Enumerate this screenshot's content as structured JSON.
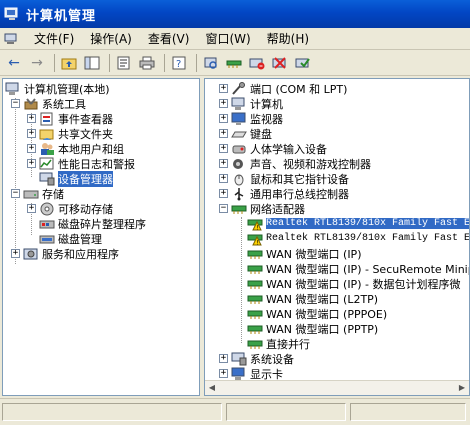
{
  "window": {
    "title": "计算机管理"
  },
  "menu": [
    "文件(F)",
    "操作(A)",
    "查看(V)",
    "窗口(W)",
    "帮助(H)"
  ],
  "left_tree": [
    {
      "label": "计算机管理(本地)",
      "level": 0,
      "expander": "",
      "icon": "computer-management-icon"
    },
    {
      "label": "系统工具",
      "level": 1,
      "expander": "−",
      "icon": "tools-icon"
    },
    {
      "label": "事件查看器",
      "level": 2,
      "expander": "+",
      "icon": "event-viewer-icon"
    },
    {
      "label": "共享文件夹",
      "level": 2,
      "expander": "+",
      "icon": "shared-folder-icon"
    },
    {
      "label": "本地用户和组",
      "level": 2,
      "expander": "+",
      "icon": "users-icon"
    },
    {
      "label": "性能日志和警报",
      "level": 2,
      "expander": "+",
      "icon": "performance-icon"
    },
    {
      "label": "设备管理器",
      "level": 2,
      "expander": "",
      "icon": "device-manager-icon",
      "selected": true
    },
    {
      "label": "存储",
      "level": 1,
      "expander": "−",
      "icon": "storage-icon"
    },
    {
      "label": "可移动存储",
      "level": 2,
      "expander": "+",
      "icon": "removable-storage-icon"
    },
    {
      "label": "磁盘碎片整理程序",
      "level": 2,
      "expander": "",
      "icon": "defrag-icon"
    },
    {
      "label": "磁盘管理",
      "level": 2,
      "expander": "",
      "icon": "disk-management-icon"
    },
    {
      "label": "服务和应用程序",
      "level": 1,
      "expander": "+",
      "icon": "services-icon"
    }
  ],
  "right_tree": [
    {
      "label": "端口 (COM 和 LPT)",
      "level": 0,
      "expander": "+",
      "icon": "port-icon"
    },
    {
      "label": "计算机",
      "level": 0,
      "expander": "+",
      "icon": "computer-icon"
    },
    {
      "label": "监视器",
      "level": 0,
      "expander": "+",
      "icon": "monitor-icon"
    },
    {
      "label": "键盘",
      "level": 0,
      "expander": "+",
      "icon": "keyboard-icon"
    },
    {
      "label": "人体学输入设备",
      "level": 0,
      "expander": "+",
      "icon": "hid-icon"
    },
    {
      "label": "声音、视频和游戏控制器",
      "level": 0,
      "expander": "+",
      "icon": "sound-icon"
    },
    {
      "label": "鼠标和其它指针设备",
      "level": 0,
      "expander": "+",
      "icon": "mouse-icon"
    },
    {
      "label": "通用串行总线控制器",
      "level": 0,
      "expander": "+",
      "icon": "usb-icon"
    },
    {
      "label": "网络适配器",
      "level": 0,
      "expander": "−",
      "icon": "network-adapter-icon"
    },
    {
      "label": "Realtek RTL8139/810x Family Fast Eth",
      "level": 1,
      "expander": "",
      "icon": "warning-adapter-icon",
      "selected": true,
      "mono": true
    },
    {
      "label": "Realtek RTL8139/810x Family Fast Eth",
      "level": 1,
      "expander": "",
      "icon": "warning-adapter-icon",
      "mono": true
    },
    {
      "label": "WAN 微型端口 (IP)",
      "level": 1,
      "expander": "",
      "icon": "adapter-icon"
    },
    {
      "label": "WAN 微型端口 (IP) - SecuRemote Minip",
      "level": 1,
      "expander": "",
      "icon": "adapter-icon"
    },
    {
      "label": "WAN 微型端口 (IP) - 数据包计划程序微",
      "level": 1,
      "expander": "",
      "icon": "adapter-icon"
    },
    {
      "label": "WAN 微型端口 (L2TP)",
      "level": 1,
      "expander": "",
      "icon": "adapter-icon"
    },
    {
      "label": "WAN 微型端口 (PPPOE)",
      "level": 1,
      "expander": "",
      "icon": "adapter-icon"
    },
    {
      "label": "WAN 微型端口 (PPTP)",
      "level": 1,
      "expander": "",
      "icon": "adapter-icon"
    },
    {
      "label": "直接并行",
      "level": 1,
      "expander": "",
      "icon": "adapter-icon"
    },
    {
      "label": "系统设备",
      "level": 0,
      "expander": "+",
      "icon": "system-devices-icon"
    },
    {
      "label": "显示卡",
      "level": 0,
      "expander": "+",
      "icon": "display-adapter-icon"
    }
  ],
  "colors": {
    "titlebar": "#0246c4",
    "selection": "#316ac5",
    "chrome": "#ece9d8"
  }
}
